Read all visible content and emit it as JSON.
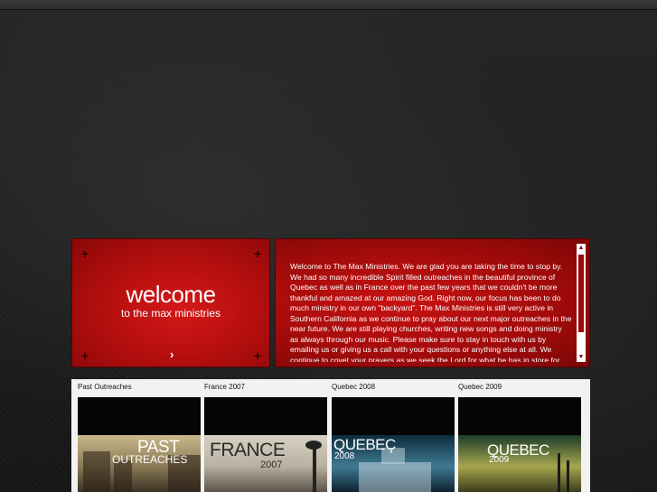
{
  "welcome": {
    "title": "welcome",
    "subtitle": "to the max ministries",
    "text": "Welcome to The Max Ministries. We are glad you are taking the time to stop by. We had so many incredible Spirit filled outreaches in the beautiful province of Quebec as well as in France over the past few years that we couldn't be more thankful and amazed at our amazing God. Right now, our focus has been to do much ministry in our own \"backyard\". The Max Ministries is still very active in Southern California as we continue to pray about our next major outreaches in the near future. We are still playing churches, writing new songs and doing ministry as always through our music. Please make sure to stay in touch with us by emailing us or giving us a call with your questions or anything else at all.  We continue to covet your prayers as we seek the Lord for what he has in store for"
  },
  "gallery": {
    "items": [
      {
        "label": "Past Outreaches",
        "title_line1": "PAST",
        "title_line2": "OUTREACHES"
      },
      {
        "label": "France 2007",
        "title_line1": "FRANCE",
        "title_line2": "2007"
      },
      {
        "label": "Quebec 2008",
        "title_line1": "QUEBEÇ",
        "title_line2": "2008"
      },
      {
        "label": "Quebec 2009",
        "title_line1": "QUEBEC",
        "title_line2": "2009"
      }
    ]
  },
  "colors": {
    "panel_red": "#c81212",
    "page_bg": "#1f1f1f",
    "gallery_bg": "#f2f2f2"
  },
  "icons": {
    "corner": "plus-icon",
    "next": "chevron-right-icon",
    "scroll_up": "triangle-up-icon",
    "scroll_down": "triangle-down-icon"
  }
}
